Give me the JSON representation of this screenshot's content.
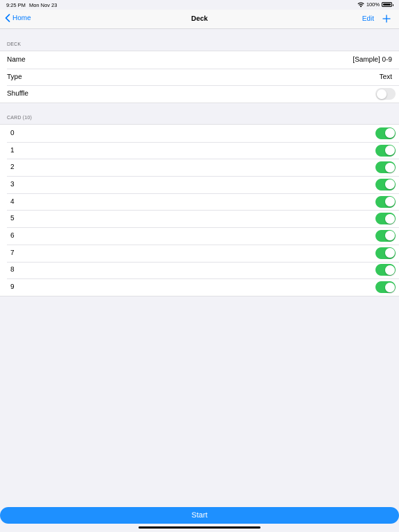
{
  "status_bar": {
    "time": "9:25 PM",
    "date": "Mon Nov 23",
    "battery": "100%"
  },
  "nav": {
    "back_label": "Home",
    "title": "Deck",
    "edit_label": "Edit"
  },
  "deck_section": {
    "header": "DECK",
    "name_label": "Name",
    "name_value": "[Sample] 0-9",
    "type_label": "Type",
    "type_value": "Text",
    "shuffle_label": "Shuffle",
    "shuffle_on": false
  },
  "card_section": {
    "header": "CARD (10)",
    "cards": [
      {
        "label": "0",
        "on": true
      },
      {
        "label": "1",
        "on": true
      },
      {
        "label": "2",
        "on": true
      },
      {
        "label": "3",
        "on": true
      },
      {
        "label": "4",
        "on": true
      },
      {
        "label": "5",
        "on": true
      },
      {
        "label": "6",
        "on": true
      },
      {
        "label": "7",
        "on": true
      },
      {
        "label": "8",
        "on": true
      },
      {
        "label": "9",
        "on": true
      }
    ]
  },
  "start_label": "Start",
  "colors": {
    "accent": "#007aff",
    "toggle_on": "#34c759",
    "start_button": "#1e90ff"
  },
  "icons": {
    "back": "chevron-left-icon",
    "add": "plus-icon",
    "wifi": "wifi-icon",
    "battery": "battery-icon"
  }
}
